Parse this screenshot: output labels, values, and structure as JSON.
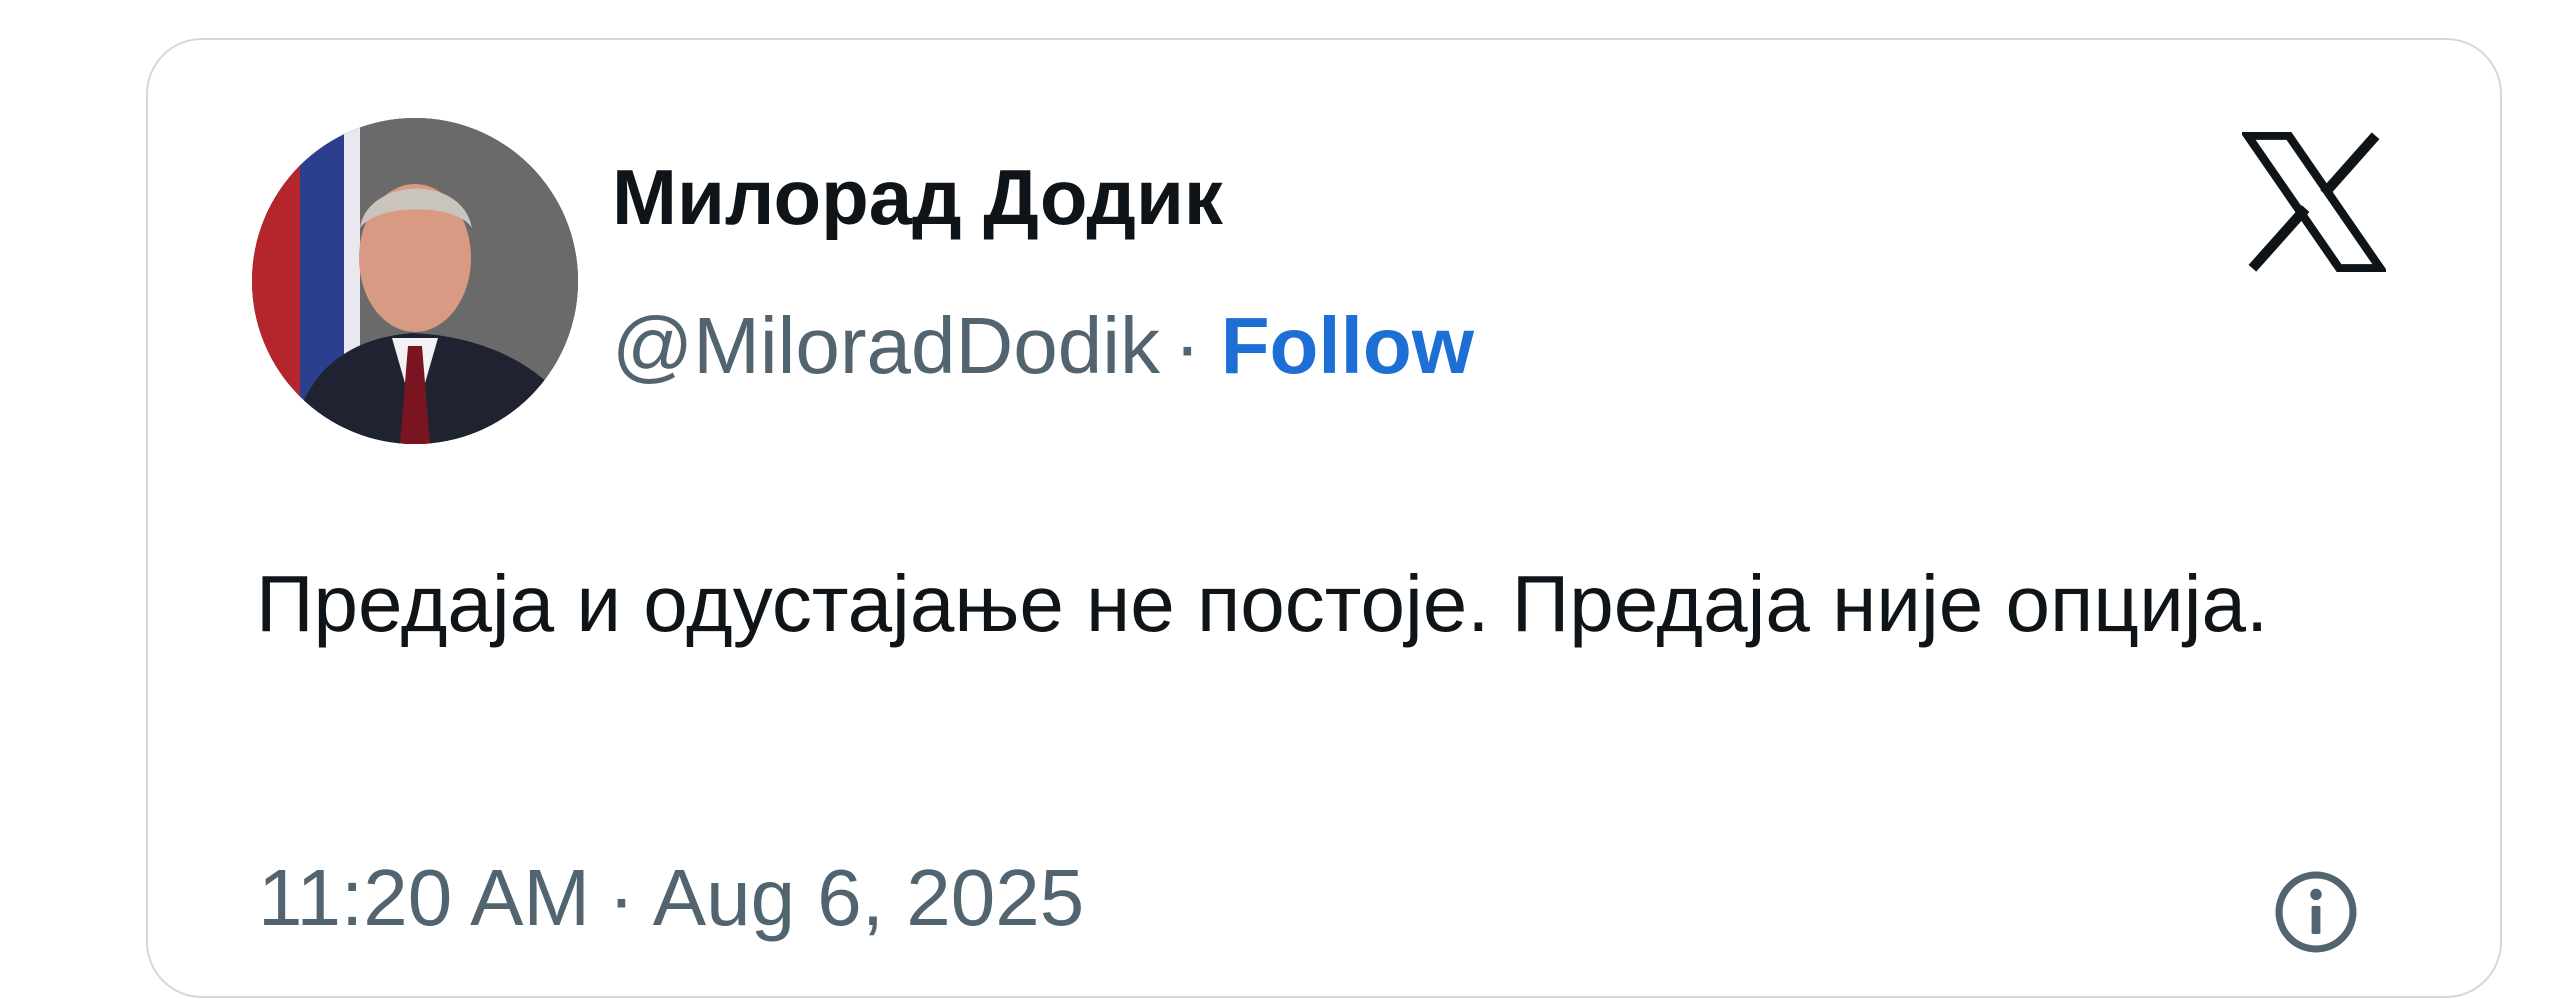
{
  "author": {
    "display_name": "Милорад Додик",
    "handle": "@MiloradDodik",
    "separator": "·",
    "follow_label": "Follow",
    "avatar_icon": "profile-photo"
  },
  "brand": {
    "logo_icon": "x-logo-icon"
  },
  "tweet": {
    "text": "Предаја и одустајање не постоје. Предаја није опција.",
    "time": "11:20 AM",
    "separator": "·",
    "date": "Aug 6, 2025"
  },
  "colors": {
    "text_primary": "#0f1419",
    "text_secondary": "#536471",
    "follow_blue": "#1d6fd6",
    "border": "#cfd9de"
  }
}
